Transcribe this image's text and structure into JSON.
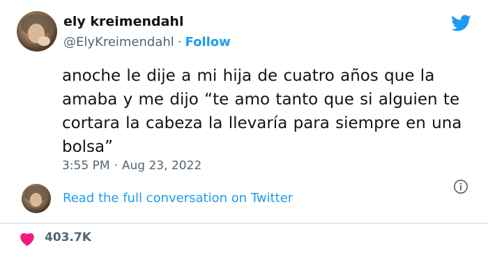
{
  "author": {
    "name": "ely kreimendahl",
    "handle": "@ElyKreimendahl",
    "separator": "·",
    "follow_label": "Follow",
    "avatar_icon": "user-avatar-photo"
  },
  "tweet": {
    "text": "anoche le dije a mi hija de cuatro años que la amaba y me dijo “te amo tanto que si alguien te cortara la cabeza la llevaría para siempre en una bolsa”",
    "time": "3:55 PM",
    "separator": "·",
    "date": "Aug 23, 2022"
  },
  "conversation": {
    "link_label": "Read the full conversation on Twitter"
  },
  "engagement": {
    "likes": "403.7K"
  },
  "icons": {
    "brand": "twitter-bird-icon",
    "info": "info-icon",
    "like": "heart-icon"
  },
  "colors": {
    "accent": "#1d9bf0",
    "like": "#f91880",
    "text": "#0f1419",
    "secondary": "#536471",
    "border": "#cfd9de"
  }
}
